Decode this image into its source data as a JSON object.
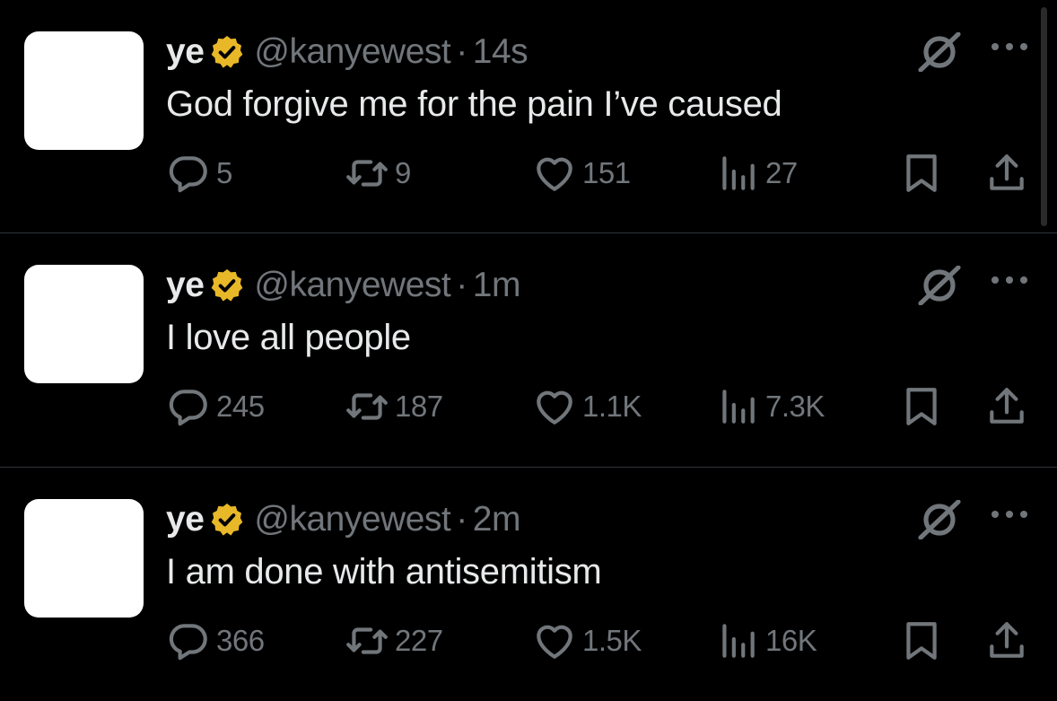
{
  "colors": {
    "background": "#000000",
    "text_primary": "#e7e9ea",
    "text_secondary": "#71767b",
    "divider": "#2f3336",
    "verified_badge": "#e8b829"
  },
  "tweets": [
    {
      "display_name": "ye",
      "handle": "@kanyewest",
      "separator": "·",
      "time": "14s",
      "text": "God forgive me for the pain I’ve caused",
      "replies": "5",
      "retweets": "9",
      "likes": "151",
      "views": "27"
    },
    {
      "display_name": "ye",
      "handle": "@kanyewest",
      "separator": "·",
      "time": "1m",
      "text": "I love all people",
      "replies": "245",
      "retweets": "187",
      "likes": "1.1K",
      "views": "7.3K"
    },
    {
      "display_name": "ye",
      "handle": "@kanyewest",
      "separator": "·",
      "time": "2m",
      "text": "I am done with antisemitism",
      "replies": "366",
      "retweets": "227",
      "likes": "1.5K",
      "views": "16K"
    }
  ],
  "icons": {
    "verified": "verified-badge-icon",
    "grok": "grok-icon",
    "more": "more-options-icon",
    "reply": "reply-icon",
    "retweet": "retweet-icon",
    "like": "like-icon",
    "views": "views-icon",
    "bookmark": "bookmark-icon",
    "share": "share-icon"
  }
}
